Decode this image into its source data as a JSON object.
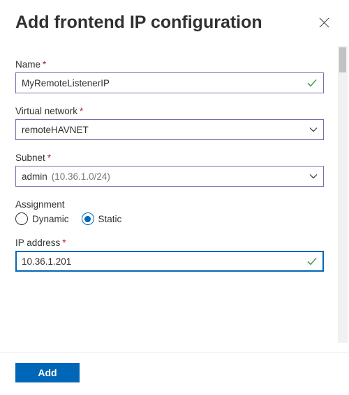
{
  "header": {
    "title": "Add frontend IP configuration"
  },
  "fields": {
    "name": {
      "label": "Name",
      "required": "*",
      "value": "MyRemoteListenerIP"
    },
    "vnet": {
      "label": "Virtual network",
      "required": "*",
      "value": "remoteHAVNET"
    },
    "subnet": {
      "label": "Subnet",
      "required": "*",
      "value": "admin",
      "detail": "(10.36.1.0/24)"
    },
    "assignment": {
      "label": "Assignment",
      "options": {
        "dynamic": "Dynamic",
        "static": "Static"
      },
      "selected": "static"
    },
    "ip": {
      "label": "IP address",
      "required": "*",
      "value": "10.36.1.201"
    }
  },
  "footer": {
    "add": "Add"
  }
}
